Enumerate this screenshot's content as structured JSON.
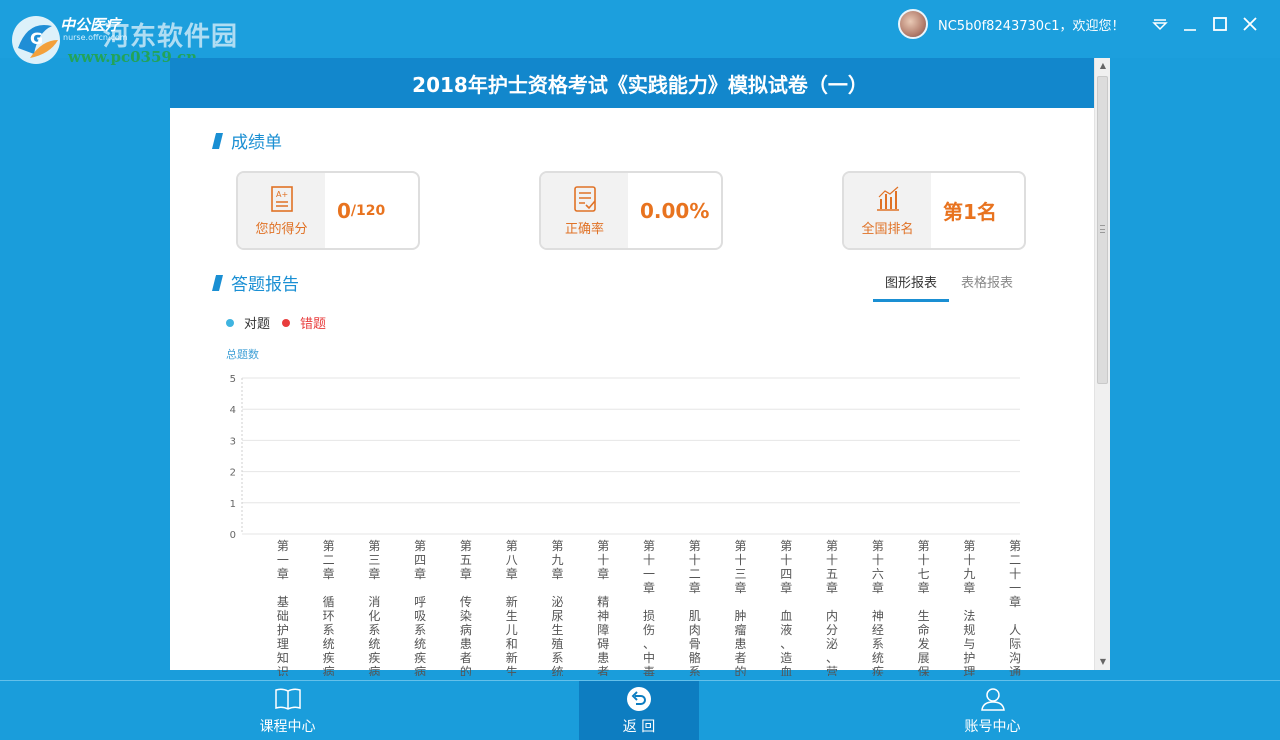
{
  "watermark": {
    "title": "河东软件园",
    "url": "www.pc0359.cn"
  },
  "logo": {
    "text": "中公医疗",
    "sub": "nurse.offcn.com"
  },
  "user": {
    "greeting": "NC5b0f8243730c1，欢迎您！"
  },
  "exam": {
    "title": "2018年护士资格考试《实践能力》模拟试卷（一）"
  },
  "scorecard": {
    "section_title": "成绩单",
    "score": {
      "label": "您的得分",
      "value": "0",
      "total": "/120"
    },
    "accuracy": {
      "label": "正确率",
      "value": "0.00%"
    },
    "rank": {
      "label": "全国排名",
      "value": "第1名"
    }
  },
  "report": {
    "section_title": "答题报告",
    "tabs": [
      "图形报表",
      "表格报表"
    ],
    "active_tab": 0
  },
  "colors": {
    "correct": "#3fb4e0",
    "wrong": "#e83d3d",
    "accent": "#1a8fd3",
    "orange": "#e8731f"
  },
  "chart_data": {
    "type": "bar",
    "ylabel": "总题数",
    "ylim": [
      0,
      5
    ],
    "yticks": [
      0,
      1,
      2,
      3,
      4,
      5
    ],
    "legend": [
      "对题",
      "错题"
    ],
    "categories": [
      {
        "chapter": "第一章",
        "topic": "基础护理知识"
      },
      {
        "chapter": "第二章",
        "topic": "循环系统疾病"
      },
      {
        "chapter": "第三章",
        "topic": "消化系统疾病"
      },
      {
        "chapter": "第四章",
        "topic": "呼吸系统疾病"
      },
      {
        "chapter": "第五章",
        "topic": "传染病患者的"
      },
      {
        "chapter": "第八章",
        "topic": "新生儿和新生"
      },
      {
        "chapter": "第九章",
        "topic": "泌尿生殖系统"
      },
      {
        "chapter": "第十章",
        "topic": "精神障碍患者"
      },
      {
        "chapter": "第十一章",
        "topic": "损伤、中毒"
      },
      {
        "chapter": "第十二章",
        "topic": "肌肉骨骼系"
      },
      {
        "chapter": "第十三章",
        "topic": "肿瘤患者的"
      },
      {
        "chapter": "第十四章",
        "topic": "血液、造血"
      },
      {
        "chapter": "第十五章",
        "topic": "内分泌、营"
      },
      {
        "chapter": "第十六章",
        "topic": "神经系统疾"
      },
      {
        "chapter": "第十七章",
        "topic": "生命发展保"
      },
      {
        "chapter": "第十九章",
        "topic": "法规与护理"
      },
      {
        "chapter": "第二十一章",
        "topic": "人际沟通"
      }
    ],
    "series": [
      {
        "name": "对题",
        "values": [
          0,
          0,
          0,
          0,
          0,
          0,
          0,
          0,
          0,
          0,
          0,
          0,
          0,
          0,
          0,
          0,
          0
        ]
      },
      {
        "name": "错题",
        "values": [
          0,
          0,
          0,
          0,
          0,
          0,
          0,
          0,
          0,
          0,
          0,
          0,
          0,
          0,
          0,
          0,
          0
        ]
      }
    ],
    "grid": true
  },
  "bottom_nav": [
    {
      "label": "课程中心",
      "icon": "book-icon"
    },
    {
      "label": "返 回",
      "icon": "back-icon"
    },
    {
      "label": "账号中心",
      "icon": "user-icon"
    }
  ]
}
